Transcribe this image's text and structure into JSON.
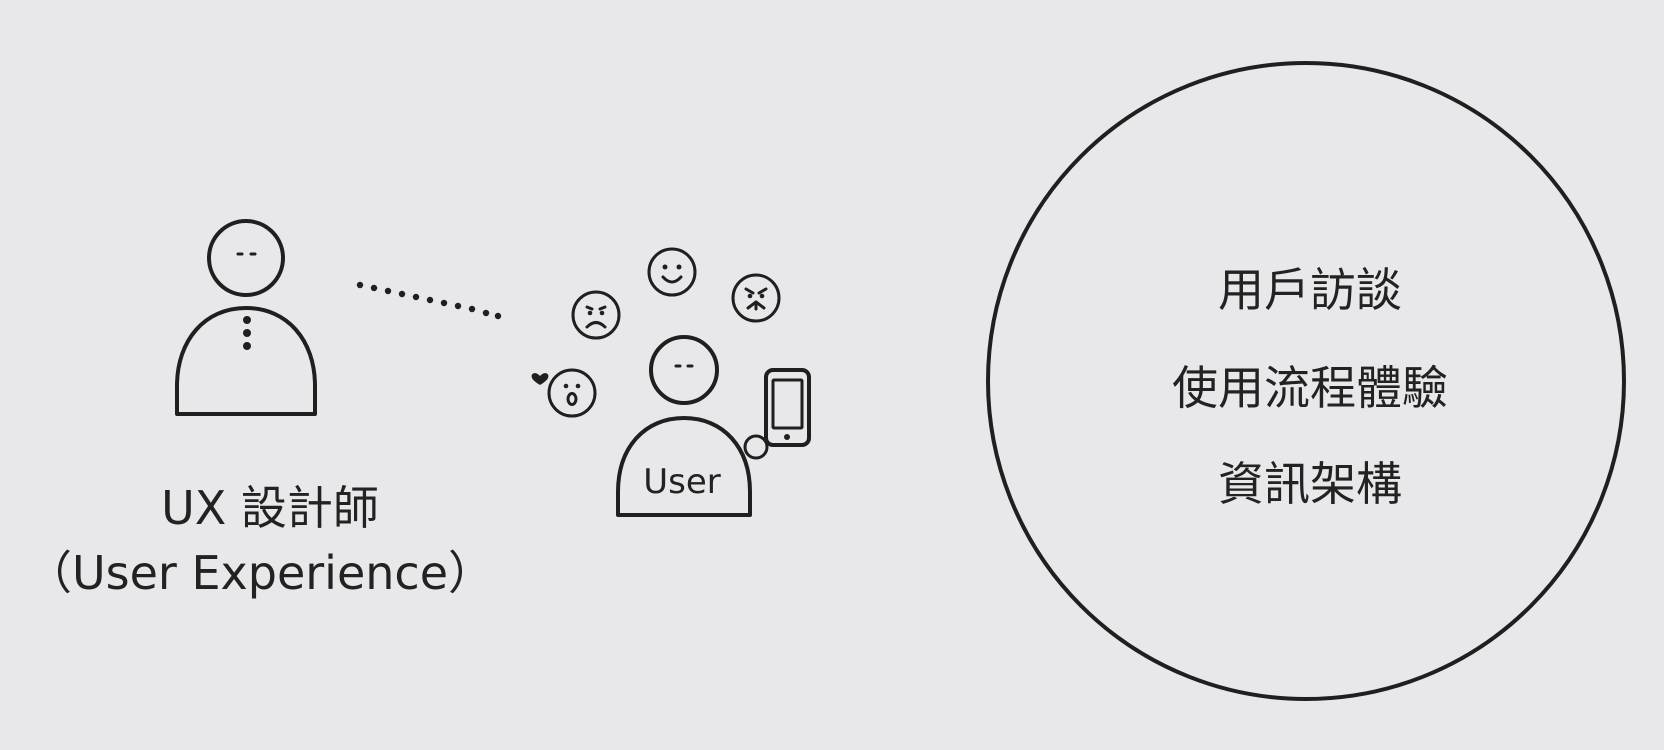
{
  "designer": {
    "label_line1": "UX 設計師",
    "label_line2": "（User Experience）"
  },
  "user": {
    "badge_label": "User"
  },
  "circle": {
    "items": [
      {
        "label": "用戶訪談"
      },
      {
        "label": "使用流程體驗"
      },
      {
        "label": "資訊架構"
      }
    ]
  },
  "icons": {
    "emotions": [
      "smile-face-icon",
      "sad-face-icon",
      "angry-face-icon",
      "surprised-face-icon",
      "heart-icon"
    ],
    "device": "smartphone-icon"
  },
  "colors": {
    "background": "#e8e8ea",
    "ink": "#1f1f1f"
  }
}
